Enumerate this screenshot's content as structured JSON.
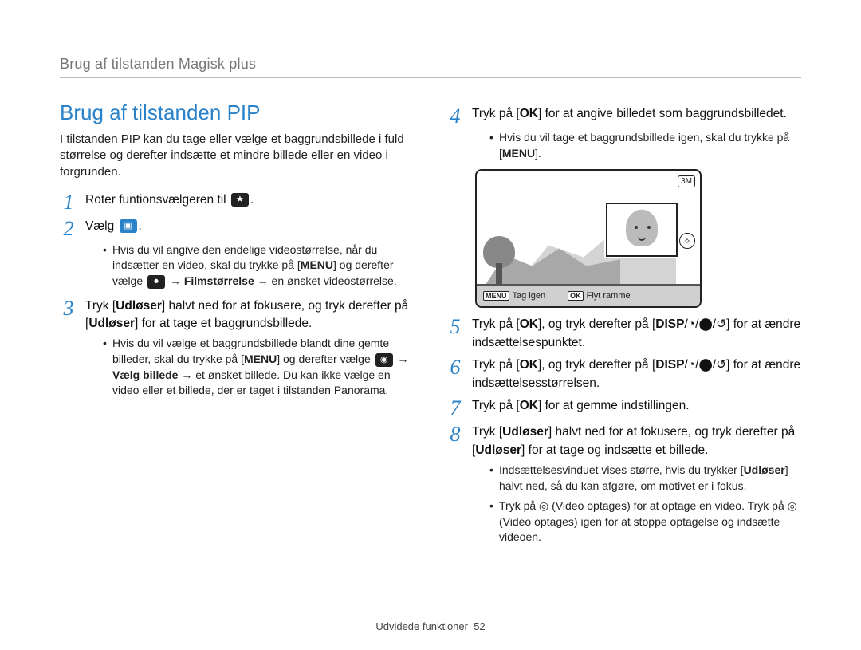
{
  "breadcrumb": "Brug af tilstanden Magisk plus",
  "title": "Brug af tilstanden PIP",
  "intro": "I tilstanden PIP kan du tage eller vælge et baggrundsbillede i fuld størrelse og derefter indsætte et mindre billede eller en video i forgrunden.",
  "steps": {
    "s1": "Roter funtionsvælgeren til ",
    "s2": "Vælg ",
    "s2_sub": {
      "a1": "Hvis du vil angive den endelige videostørrelse, når du indsætter en video, skal du trykke på [",
      "a2": "] og derefter vælge ",
      "a3_bold": "Filmstørrelse",
      "a4": " → en ønsket videostørrelse."
    },
    "s3_a": "Tryk [",
    "s3_b": "] halvt ned for at fokusere, og tryk derefter på [",
    "s3_c": "] for at tage et baggrundsbillede.",
    "s3_label": "Udløser",
    "s3_sub": {
      "a1": "Hvis du vil vælge et baggrundsbillede blandt dine gemte billeder, skal du trykke på [",
      "a2": "] og derefter vælge ",
      "a3_bold": "Vælg billede",
      "a4": " → et ønsket billede. Du kan ikke vælge en video eller et billede, der er taget i tilstanden Panorama."
    },
    "s4_a": "Tryk på [",
    "s4_b": "] for at angive billedet som baggrundsbilledet.",
    "s4_sub_a": "Hvis du vil tage et baggrundsbillede igen, skal du trykke på [",
    "s4_sub_b": "].",
    "s5_a": "Tryk på [",
    "s5_b": "], og tryk derefter på [",
    "s5_c": "] for at ændre indsættelsespunktet.",
    "s6_a": "Tryk på [",
    "s6_b": "], og tryk derefter på [",
    "s6_c": "] for at ændre indsættelsesstørrelsen.",
    "s7_a": "Tryk på [",
    "s7_b": "] for at gemme indstillingen.",
    "s8_a": "Tryk [",
    "s8_b": "] halvt ned for at fokusere, og tryk derefter på [",
    "s8_c": "] for at tage og indsætte et billede.",
    "s8_sub1_a": "Indsættelsesvinduet vises større, hvis du trykker [",
    "s8_sub1_b": "] halvt ned, så du kan afgøre, om motivet er i fokus.",
    "s8_sub2": "Tryk på ◎ (Video optages) for at optage en video. Tryk på ◎ (Video optages) igen for at stoppe optagelse og indsætte videoen."
  },
  "labels": {
    "menu": "MENU",
    "ok": "OK",
    "disp": "DISP",
    "udloser": "Udløser",
    "arrow": "→"
  },
  "preview": {
    "corner_badge": "3M",
    "side_badge": "✧",
    "bottom_left_chip": "MENU",
    "bottom_left_text": "Tag igen",
    "bottom_right_chip": "OK",
    "bottom_right_text": "Flyt ramme"
  },
  "footer": {
    "section": "Udvidede funktioner",
    "page": "52"
  }
}
